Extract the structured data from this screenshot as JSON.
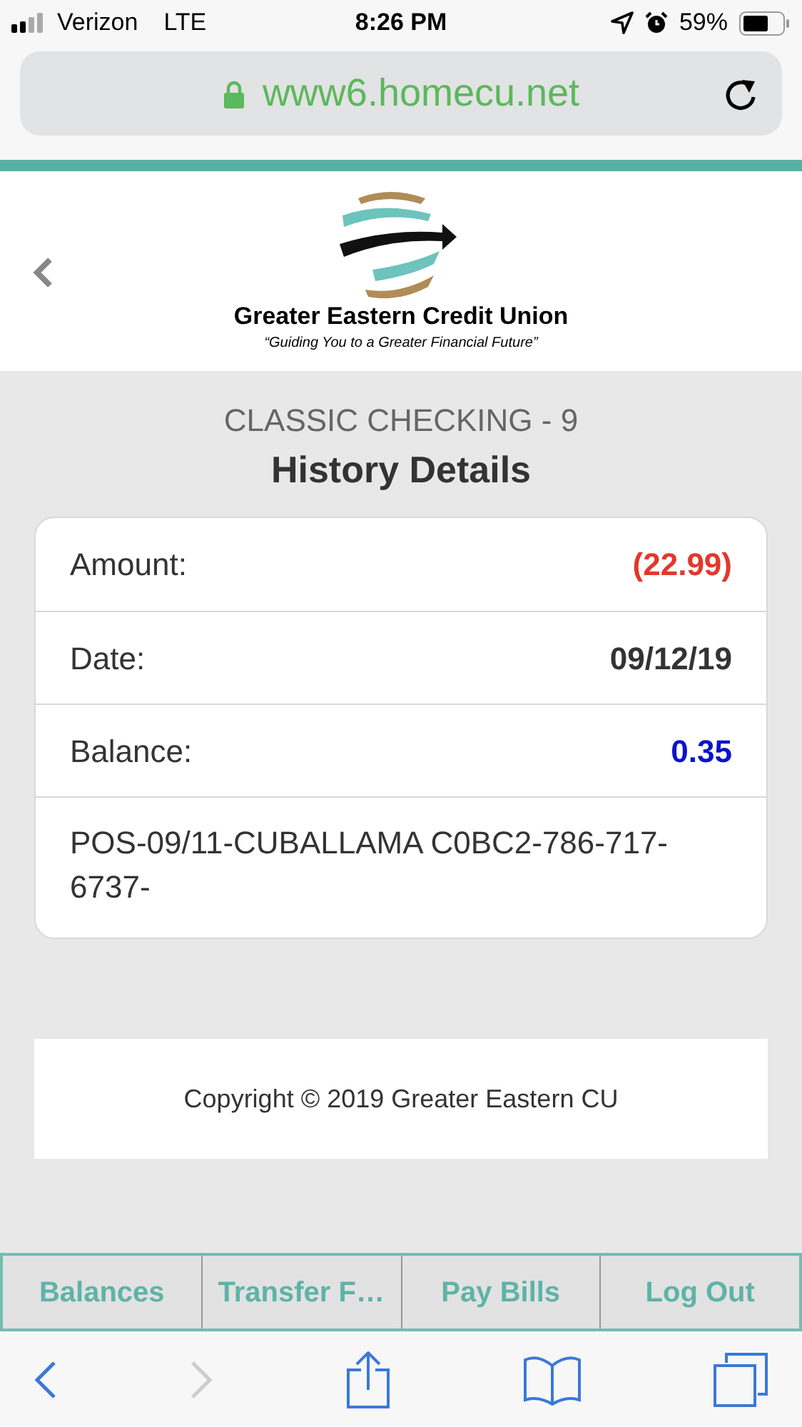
{
  "status_bar": {
    "carrier": "Verizon",
    "network": "LTE",
    "time": "8:26 PM",
    "battery": "59%"
  },
  "address_bar": {
    "url": "www6.homecu.net"
  },
  "header": {
    "logo_name": "Greater Eastern Credit Union",
    "logo_tagline": "“Guiding You to a Greater Financial Future”"
  },
  "account": "CLASSIC CHECKING - 9",
  "heading": "History Details",
  "details": [
    {
      "kind": "field",
      "label": "Amount:",
      "value": "(22.99)",
      "color": "#e0392b"
    },
    {
      "kind": "field",
      "label": "Date:",
      "value": "09/12/19",
      "color": "#333333"
    },
    {
      "kind": "field",
      "label": "Balance:",
      "value": "0.35",
      "color": "#0a14c8"
    },
    {
      "kind": "memo",
      "text": "POS-09/11-CUBALLAMA C0BC2-786-717-6737-"
    }
  ],
  "footer": "Copyright © 2019 Greater Eastern CU",
  "nav_tabs": [
    "Balances",
    "Transfer F…",
    "Pay Bills",
    "Log Out"
  ],
  "browser_toolbar": {
    "back_disabled": false,
    "forward_disabled": true
  }
}
